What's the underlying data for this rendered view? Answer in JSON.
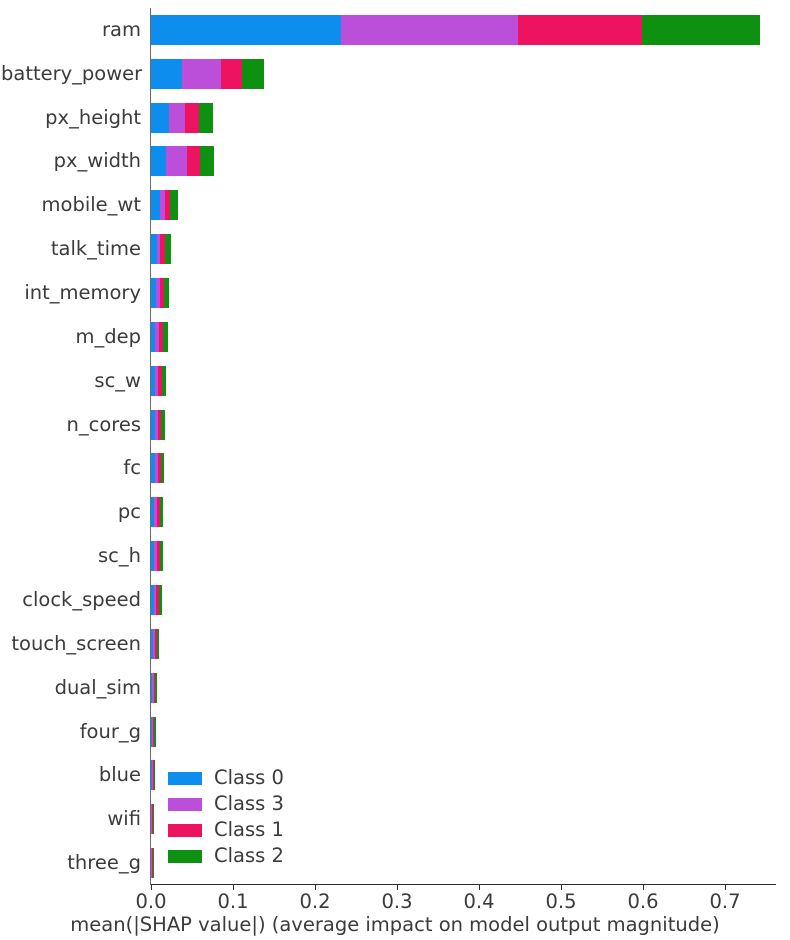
{
  "chart_data": {
    "type": "bar",
    "subtype": "stacked-horizontal",
    "title": "",
    "xlabel": "mean(|SHAP value|) (average impact on model output magnitude)",
    "ylabel": "",
    "xlim": [
      0.0,
      0.7667
    ],
    "xticks": [
      0.0,
      0.1,
      0.2,
      0.3,
      0.4,
      0.5,
      0.6,
      0.7
    ],
    "xtick_labels": [
      "0.0",
      "0.1",
      "0.2",
      "0.3",
      "0.4",
      "0.5",
      "0.6",
      "0.7"
    ],
    "grid": false,
    "legend_position": "lower-left-inside",
    "categories": [
      "ram",
      "battery_power",
      "px_height",
      "px_width",
      "mobile_wt",
      "talk_time",
      "int_memory",
      "m_dep",
      "sc_w",
      "n_cores",
      "fc",
      "pc",
      "sc_h",
      "clock_speed",
      "touch_screen",
      "dual_sim",
      "four_g",
      "blue",
      "wifi",
      "three_g"
    ],
    "series": [
      {
        "name": "Class 0",
        "color": "#0d8ded",
        "values": [
          0.2317,
          0.0378,
          0.022,
          0.0183,
          0.011,
          0.0073,
          0.0061,
          0.0049,
          0.0049,
          0.0049,
          0.0049,
          0.0037,
          0.0037,
          0.0037,
          0.0024,
          0.0018,
          0.0012,
          0.0012,
          0.0006,
          0.0006
        ]
      },
      {
        "name": "Class 3",
        "color": "#bb4fd9",
        "values": [
          0.2159,
          0.0476,
          0.0195,
          0.0256,
          0.0061,
          0.0037,
          0.0049,
          0.0049,
          0.0037,
          0.0037,
          0.0037,
          0.0037,
          0.0037,
          0.0024,
          0.0024,
          0.0018,
          0.0018,
          0.0012,
          0.0012,
          0.0006
        ]
      },
      {
        "name": "Class 1",
        "color": "#ed1361",
        "values": [
          0.1512,
          0.0256,
          0.0171,
          0.0159,
          0.0061,
          0.0061,
          0.0049,
          0.0049,
          0.0049,
          0.0037,
          0.0037,
          0.0037,
          0.0037,
          0.0037,
          0.0024,
          0.0018,
          0.0012,
          0.0012,
          0.0012,
          0.0012
        ]
      },
      {
        "name": "Class 2",
        "color": "#0e9010",
        "values": [
          0.1439,
          0.0268,
          0.0171,
          0.0171,
          0.0098,
          0.0073,
          0.0061,
          0.0061,
          0.0049,
          0.0049,
          0.0037,
          0.0037,
          0.0037,
          0.0037,
          0.0024,
          0.0024,
          0.0018,
          0.0012,
          0.0012,
          0.0006
        ]
      }
    ],
    "totals": [
      0.7427,
      0.1378,
      0.0757,
      0.0769,
      0.033,
      0.0244,
      0.022,
      0.0208,
      0.0184,
      0.0172,
      0.016,
      0.0148,
      0.0148,
      0.0135,
      0.0096,
      0.0078,
      0.006,
      0.0048,
      0.0042,
      0.003
    ]
  },
  "legend": {
    "items": [
      {
        "label": "Class 0",
        "color": "#0d8ded"
      },
      {
        "label": "Class 3",
        "color": "#bb4fd9"
      },
      {
        "label": "Class 1",
        "color": "#ed1361"
      },
      {
        "label": "Class 2",
        "color": "#0e9010"
      }
    ]
  }
}
